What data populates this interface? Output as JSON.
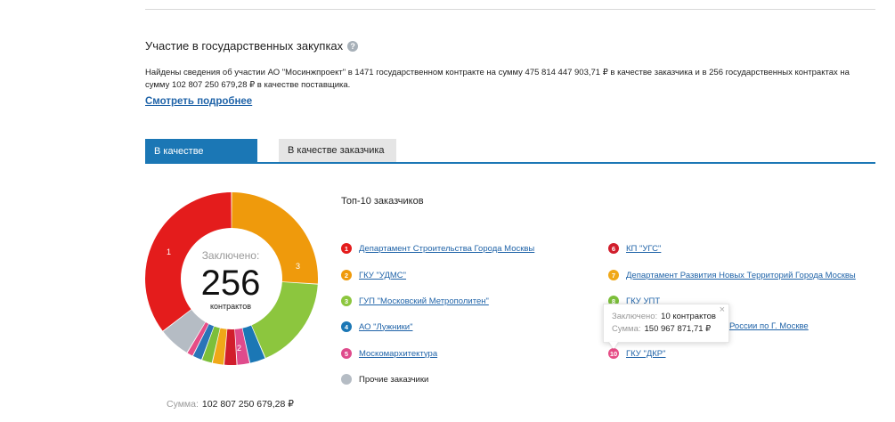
{
  "section": {
    "title": "Участие в государственных закупках",
    "summary": "Найдены сведения об участии АО \"Мосинжпроект\" в 1471 государственном контракте на сумму 475 814 447 903,71 ₽ в качестве заказчика и в 256 государственных контрактах на сумму 102 807 250 679,28 ₽ в качестве поставщика.",
    "more_link": "Смотреть подробнее"
  },
  "tabs": [
    {
      "label": "В качестве поставщика",
      "active": true
    },
    {
      "label": "В качестве заказчика",
      "active": false
    }
  ],
  "donut": {
    "top_label": "Заключено:",
    "count": "256",
    "bottom_label": "контрактов",
    "sum_label": "Сумма:",
    "sum_value": "102 807 250 679,28 ₽"
  },
  "chart_data": {
    "type": "pie",
    "categories": [
      "1",
      "2",
      "3",
      "4",
      "5",
      "6",
      "7",
      "8",
      "9",
      "10",
      "other"
    ],
    "values": [
      35.4,
      26.0,
      17.6,
      3.0,
      2.4,
      2.4,
      2.2,
      2.0,
      1.8,
      1.2,
      6.0
    ],
    "colors": [
      "#e41c1c",
      "#ef9a0c",
      "#8cc63e",
      "#1b77b5",
      "#df4b8c",
      "#d11e2c",
      "#f0a818",
      "#7cbf3a",
      "#2a74b8",
      "#e64d86",
      "#b5bcc4"
    ]
  },
  "top10": {
    "title": "Топ-10 заказчиков",
    "items": [
      {
        "num": "1",
        "label": "Департамент Строительства Города Москвы",
        "color": "#e41c1c"
      },
      {
        "num": "2",
        "label": "ГКУ \"УДМС\"",
        "color": "#ef9a0c"
      },
      {
        "num": "3",
        "label": "ГУП \"Московский Метрополитен\"",
        "color": "#8cc63e"
      },
      {
        "num": "4",
        "label": "АО \"Лужники\"",
        "color": "#1b77b5"
      },
      {
        "num": "5",
        "label": "Москомархитектура",
        "color": "#df4b8c"
      },
      {
        "num": "6",
        "label": "КП \"УГС\"",
        "color": "#d11e2c"
      },
      {
        "num": "7",
        "label": "Департамент Развития Новых Территорий Города Москвы",
        "color": "#f0a818"
      },
      {
        "num": "8",
        "label": "ГКУ УПТ",
        "color": "#7cbf3a"
      },
      {
        "num": "9",
        "label": "России по Г. Москве",
        "color": "#2a74b8"
      },
      {
        "num": "10",
        "label": "ГКУ \"ДКР\"",
        "color": "#e64d86"
      }
    ],
    "other": {
      "label": "Прочие заказчики",
      "color": "#b5bcc4"
    }
  },
  "tooltip": {
    "row1_label": "Заключено:",
    "row1_value": "10 контрактов",
    "row2_label": "Сумма:",
    "row2_value": "150 967 871,71 ₽"
  }
}
